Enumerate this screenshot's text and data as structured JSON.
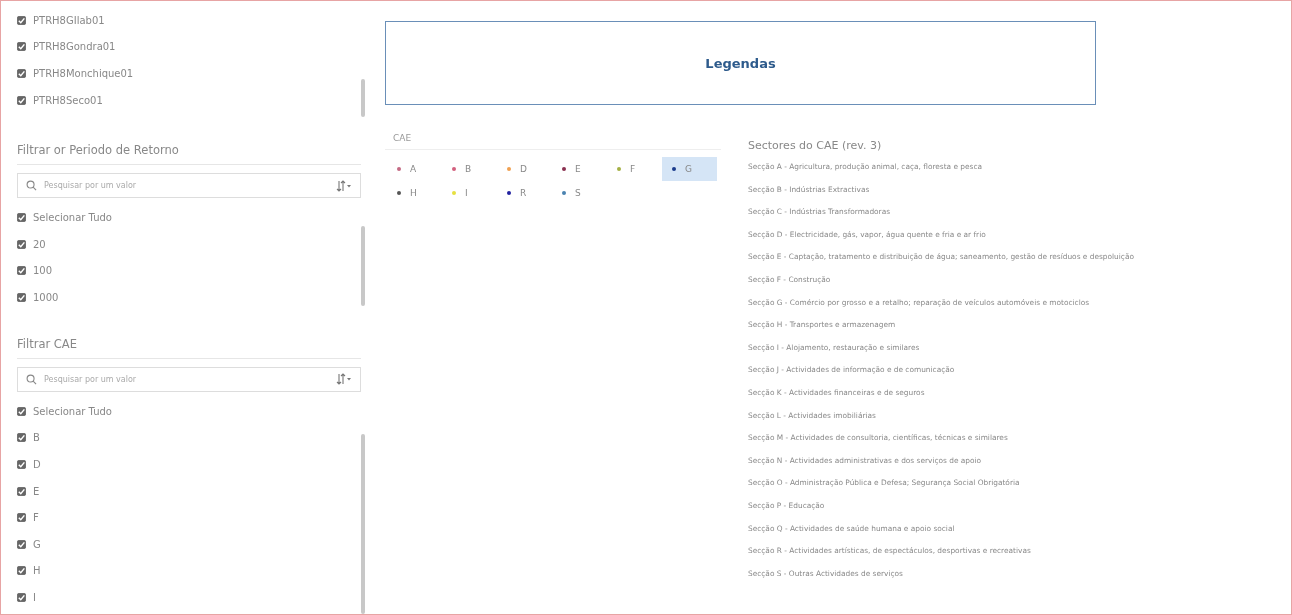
{
  "station_list": {
    "items": [
      {
        "label": "PTRH8GIlab01",
        "checked": true
      },
      {
        "label": "PTRH8Gondra01",
        "checked": true
      },
      {
        "label": "PTRH8Monchique01",
        "checked": true
      },
      {
        "label": "PTRH8Seco01",
        "checked": true
      }
    ]
  },
  "return_period_filter": {
    "title": "Filtrar or Periodo de Retorno",
    "search": {
      "placeholder": "Pesquisar por um valor"
    },
    "items": [
      {
        "label": "Selecionar Tudo",
        "checked": true
      },
      {
        "label": "20",
        "checked": true
      },
      {
        "label": "100",
        "checked": true
      },
      {
        "label": "1000",
        "checked": true
      }
    ]
  },
  "cae_filter": {
    "title": "Filtrar CAE",
    "search": {
      "placeholder": "Pesquisar por um valor"
    },
    "items": [
      {
        "label": "Selecionar Tudo",
        "checked": true
      },
      {
        "label": "B",
        "checked": true
      },
      {
        "label": "D",
        "checked": true
      },
      {
        "label": "E",
        "checked": true
      },
      {
        "label": "F",
        "checked": true
      },
      {
        "label": "G",
        "checked": true
      },
      {
        "label": "H",
        "checked": true
      },
      {
        "label": "I",
        "checked": true
      }
    ]
  },
  "legend_title": "Legendas",
  "cae_legend": {
    "title": "CAE",
    "items": [
      {
        "label": "A",
        "color": "#c46a84",
        "selected": false
      },
      {
        "label": "B",
        "color": "#d2607e",
        "selected": false
      },
      {
        "label": "D",
        "color": "#f0a050",
        "selected": false
      },
      {
        "label": "E",
        "color": "#8a3050",
        "selected": false
      },
      {
        "label": "F",
        "color": "#a4b044",
        "selected": false
      },
      {
        "label": "G",
        "color": "#1a3c8c",
        "selected": true
      },
      {
        "label": "H",
        "color": "#555555",
        "selected": false
      },
      {
        "label": "I",
        "color": "#e6e040",
        "selected": false
      },
      {
        "label": "R",
        "color": "#2222a0",
        "selected": false
      },
      {
        "label": "S",
        "color": "#4a82b0",
        "selected": false
      }
    ]
  },
  "sectors": {
    "title": "Sectores do CAE (rev. 3)",
    "items": [
      "Secção A - Agricultura, produção animal, caça, floresta e pesca",
      "Secção B - Indústrias Extractivas",
      "Secção C - Indústrias Transformadoras",
      "Secção D - Electricidade, gás, vapor, água quente e fria e ar frio",
      "Secção E - Captação, tratamento e distribuição de água; saneamento, gestão de resíduos e despoluição",
      "Secção F - Construção",
      "Secção G - Comércio por grosso e a retalho; reparação de veículos automóveis e motociclos",
      "Secção H - Transportes e armazenagem",
      "Secção I - Alojamento, restauração e similares",
      "Secção J - Actividades de informação e de comunicação",
      "Secção K - Actividades financeiras e de seguros",
      "Secção L - Actividades imobiliárias",
      "Secção M - Actividades de consultoria, científicas, técnicas e similares",
      "Secção N - Actividades administrativas e dos serviços de apoio",
      "Secção O - Administração Pública e Defesa; Segurança Social Obrigatória",
      "Secção P - Educação",
      "Secção Q - Actividades de saúde humana e apoio social",
      "Secção R - Actividades artísticas, de espectáculos, desportivas e recreativas",
      "Secção S - Outras Actividades de serviços"
    ]
  }
}
